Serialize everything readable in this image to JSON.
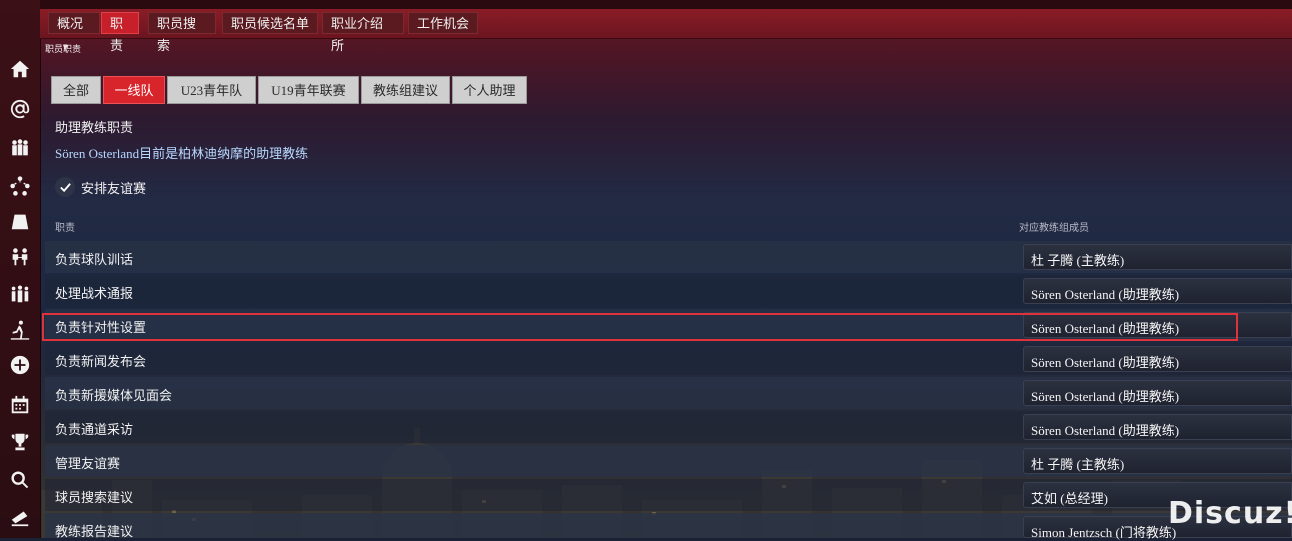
{
  "topnav": {
    "items": [
      {
        "label": "概况",
        "active": false,
        "has_dropdown": true
      },
      {
        "label": "职责",
        "active": true
      },
      {
        "label": "职员搜索",
        "active": false
      },
      {
        "label": "职员候选名单",
        "active": false
      },
      {
        "label": "职业介绍所",
        "active": false
      },
      {
        "label": "工作机会",
        "active": false
      }
    ]
  },
  "breadcrumb": "职员职责",
  "subtabs": [
    {
      "label": "全部",
      "active": false
    },
    {
      "label": "一线队",
      "active": true
    },
    {
      "label": "U23青年队",
      "active": false
    },
    {
      "label": "U19青年联赛",
      "active": false
    },
    {
      "label": "教练组建议",
      "active": false
    },
    {
      "label": "个人助理",
      "active": false
    }
  ],
  "section": {
    "title": "助理教练职责",
    "description": "Sören Osterland目前是柏林迪纳摩的助理教练"
  },
  "checkbox": {
    "label": "安排友谊赛",
    "checked": true
  },
  "columns": {
    "duty": "职责",
    "staff": "对应教练组成员"
  },
  "duties": [
    {
      "label": "负责球队训话",
      "staff": "杜 子腾 (主教练)"
    },
    {
      "label": "处理战术通报",
      "staff": "Sören Osterland (助理教练)"
    },
    {
      "label": "负责针对性设置",
      "staff": "Sören Osterland (助理教练)"
    },
    {
      "label": "负责新闻发布会",
      "staff": "Sören Osterland (助理教练)"
    },
    {
      "label": "负责新援媒体见面会",
      "staff": "Sören Osterland (助理教练)"
    },
    {
      "label": "负责通道采访",
      "staff": "Sören Osterland (助理教练)"
    },
    {
      "label": "管理友谊赛",
      "staff": "杜 子腾 (主教练)"
    },
    {
      "label": "球员搜索建议",
      "staff": "艾如 (总经理)"
    },
    {
      "label": "教练报告建议",
      "staff": "Simon Jentzsch (门将教练)"
    }
  ],
  "sidebar": {
    "icons": [
      "home-icon",
      "at-icon",
      "squad-icon",
      "tactics-icon",
      "training-ground-icon",
      "staff-icon",
      "team-icon",
      "training-icon",
      "plus-icon",
      "calendar-icon",
      "trophy-icon",
      "search-icon",
      "scouting-icon"
    ]
  },
  "watermark": "Discuz!",
  "colors": {
    "accent": "#d8252c",
    "highlight_border": "#e0323a",
    "link_blue": "#b8d8ff"
  }
}
